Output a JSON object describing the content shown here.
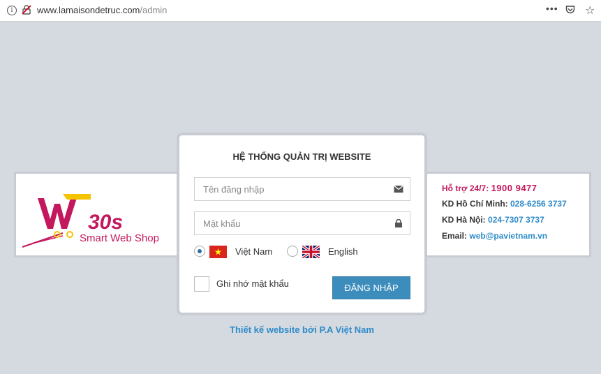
{
  "browser": {
    "url_host": "www.lamaisondetruc.com",
    "url_path": "/admin",
    "menu_glyph": "•••",
    "star_glyph": "☆"
  },
  "logo": {
    "brand_big": "W",
    "brand_num": "30s",
    "tagline": "Smart Web Shop"
  },
  "login": {
    "title": "HỆ THỐNG QUẢN TRỊ WEBSITE",
    "username_placeholder": "Tên đăng nhập",
    "password_placeholder": "Mật khẩu",
    "languages": [
      {
        "label": "Việt Nam",
        "selected": true
      },
      {
        "label": "English",
        "selected": false
      }
    ],
    "remember_label": "Ghi nhớ mật khẩu",
    "submit_label": "ĐĂNG NHẬP"
  },
  "contact": {
    "support_label": "Hỗ trợ 24/7:",
    "support_phone": "1900 9477",
    "hcm_label": "KD Hồ Chí Minh:",
    "hcm_phone": "028-6256 3737",
    "hn_label": "KD Hà Nội:",
    "hn_phone": "024-7307 3737",
    "email_label": "Email:",
    "email_value": "web@pavietnam.vn"
  },
  "footer": {
    "credit": "Thiết kế website bởi P.A Việt Nam"
  },
  "colors": {
    "accent_blue": "#3c8dbc",
    "brand_magenta": "#c3185d",
    "brand_yellow": "#f5c400",
    "link_blue": "#2e8bc9",
    "background": "#d5d9e0"
  }
}
